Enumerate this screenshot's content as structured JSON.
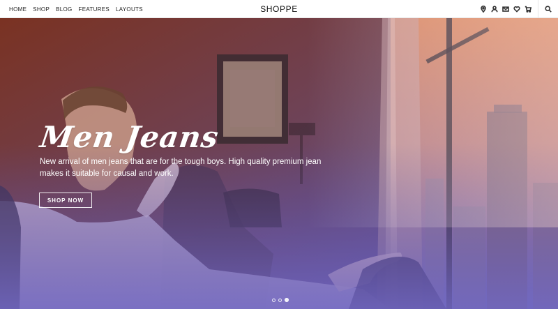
{
  "nav": {
    "links": [
      "HOME",
      "SHOP",
      "BLOG",
      "FEATURES",
      "LAYOUTS"
    ],
    "brand": "SHOPPE",
    "icons": [
      "location-pin-icon",
      "user-icon",
      "mail-icon",
      "heart-icon",
      "cart-icon",
      "search-icon"
    ]
  },
  "hero": {
    "title": "Men Jeans",
    "description": "New arrival of men jeans that are for the tough boys. High quality premium jean makes it suitable for causal and work.",
    "button_label": "SHOP NOW",
    "slides_total": 3,
    "active_slide": 3
  },
  "colors": {
    "gradient_top_left": "#8a3a2a",
    "gradient_top_right": "#d98a66",
    "gradient_bottom": "#5a4fa6",
    "text": "#ffffff"
  }
}
